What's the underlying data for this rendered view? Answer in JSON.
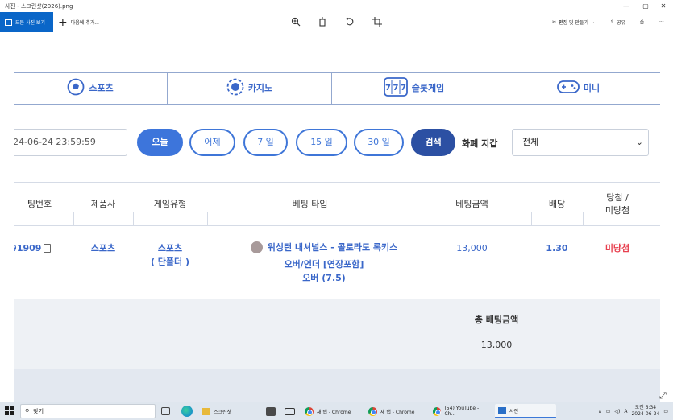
{
  "window": {
    "title": "사진 - 스크린샷(2026).png",
    "controls": [
      "—",
      "▢",
      "✕"
    ]
  },
  "toolbar": {
    "all_photos": "모든 사진 보기",
    "add_to": "다음에 추가...",
    "edit_create": "편집 및 만들기",
    "share": "공유"
  },
  "site": {
    "tabs": [
      {
        "label": "스포츠",
        "icon": "soccer-ball-icon"
      },
      {
        "label": "카지노",
        "icon": "casino-chip-icon"
      },
      {
        "label": "슬롯게임",
        "icon": "slot-machine-icon"
      },
      {
        "label": "미니",
        "icon": "gamepad-icon"
      }
    ],
    "filters": {
      "date_value": "24-06-24 23:59:59",
      "today": "오늘",
      "yesterday": "어제",
      "days7": "7 일",
      "days15": "15 일",
      "days30": "30 일",
      "search": "검색",
      "currency_label": "화폐 지갑",
      "currency_selected": "전체"
    },
    "table": {
      "headers": {
        "bet_no": "팅번호",
        "provider": "제품사",
        "game_type": "게임유형",
        "bet_type": "베팅 타입",
        "bet_amount": "베팅금액",
        "odds": "배당",
        "result_line1": "당첨 /",
        "result_line2": "미당첨"
      },
      "row": {
        "bet_no": ".91909",
        "provider": "스포츠",
        "game_type": "스포츠",
        "game_sub": "( 단폴더 )",
        "match": "워싱턴 내셔널스 - 콜로라도 록키스",
        "market": "오버/언더 [연장포함]",
        "pick": "오버 (7.5)",
        "amount": "13,000",
        "odds": "1.30",
        "result": "미당첨"
      }
    },
    "summary": {
      "label": "총 배팅금액",
      "value": "13,000"
    }
  },
  "taskbar": {
    "search_placeholder": "찾기",
    "apps": [
      {
        "label": "스크린샷"
      },
      {
        "label": "새 탭 - Chrome"
      },
      {
        "label": "새 탭 - Chrome"
      },
      {
        "label": "(54) YouTube - Ch..."
      },
      {
        "label": "사진"
      }
    ],
    "time": "오전 6:34",
    "date": "2024-06-24",
    "lang": "A"
  },
  "colors": {
    "accent_blue": "#3a67c9",
    "button_blue": "#3d75db",
    "search_dark": "#2c50a3",
    "loss_red": "#e8404f",
    "photos_blue": "#0a66c8"
  }
}
